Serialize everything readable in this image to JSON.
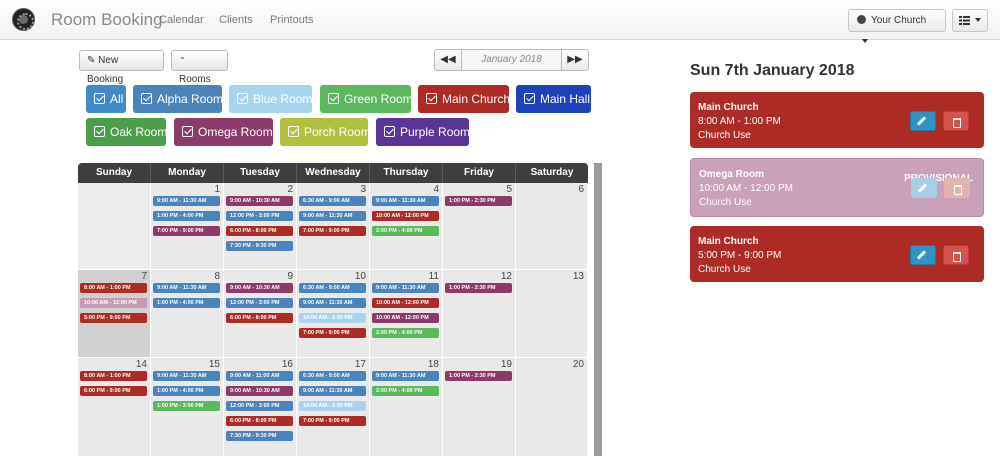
{
  "navbar": {
    "brand": "Room Booking",
    "links": [
      "Calendar",
      "Clients",
      "Printouts"
    ],
    "church_selector": "Your Church"
  },
  "toolbar": {
    "new_booking": "New Booking",
    "rooms": "Rooms",
    "month_label": "January 2018"
  },
  "rooms": [
    {
      "label": "All",
      "color": "#428bca"
    },
    {
      "label": "Alpha Room",
      "color": "#4a84bb"
    },
    {
      "label": "Blue Room",
      "color": "#a9d4ee"
    },
    {
      "label": "Green Room",
      "color": "#5cb85c"
    },
    {
      "label": "Main Church",
      "color": "#ac2b24"
    },
    {
      "label": "Main Hall",
      "color": "#1c44b8"
    },
    {
      "label": "Oak Room",
      "color": "#4b9f4b"
    },
    {
      "label": "Omega Room",
      "color": "#8b3a6a"
    },
    {
      "label": "Porch Room",
      "color": "#b3bf3e"
    },
    {
      "label": "Purple Room",
      "color": "#5b3596"
    }
  ],
  "calendar": {
    "weekdays": [
      "Sunday",
      "Monday",
      "Tuesday",
      "Wednesday",
      "Thursday",
      "Friday",
      "Saturday"
    ],
    "weeks": [
      {
        "days": [
          {
            "num": "",
            "events": []
          },
          {
            "num": "1",
            "events": [
              [
                "9:00 AM - 11:30 AM",
                "#4a84bb"
              ],
              [
                "1:00 PM - 4:00 PM",
                "#4a84bb"
              ],
              [
                "7:00 PM - 9:00 PM",
                "#8b3a6a"
              ]
            ]
          },
          {
            "num": "2",
            "events": [
              [
                "9:00 AM - 10:30 AM",
                "#8b3a6a"
              ],
              [
                "12:00 PM - 3:00 PM",
                "#4a84bb"
              ],
              [
                "6:00 PM - 8:00 PM",
                "#ac2b24"
              ],
              [
                "7:30 PM - 9:30 PM",
                "#4a84bb"
              ]
            ]
          },
          {
            "num": "3",
            "events": [
              [
                "6:30 AM - 9:00 AM",
                "#4a84bb"
              ],
              [
                "9:00 AM - 11:30 AM",
                "#4a84bb"
              ],
              [
                "7:00 PM - 9:00 PM",
                "#ac2b24"
              ]
            ]
          },
          {
            "num": "4",
            "events": [
              [
                "9:00 AM - 11:30 AM",
                "#4a84bb"
              ],
              [
                "10:00 AM - 12:00 PM",
                "#ac2b24"
              ],
              [
                "2:00 PM - 4:00 PM",
                "#5cb85c"
              ]
            ]
          },
          {
            "num": "5",
            "events": [
              [
                "1:00 PM - 2:30 PM",
                "#8b3a6a"
              ]
            ]
          },
          {
            "num": "6",
            "events": []
          }
        ]
      },
      {
        "days": [
          {
            "num": "7",
            "events": [
              [
                "8:00 AM - 1:00 PM",
                "#ac2b24"
              ],
              [
                "10:00 AM - 12:00 PM",
                "#c49bb3"
              ],
              [
                "5:00 PM - 9:00 PM",
                "#ac2b24"
              ]
            ]
          },
          {
            "num": "8",
            "events": [
              [
                "9:00 AM - 11:30 AM",
                "#4a84bb"
              ],
              [
                "1:00 PM - 4:00 PM",
                "#4a84bb"
              ]
            ]
          },
          {
            "num": "9",
            "events": [
              [
                "9:00 AM - 10:30 AM",
                "#8b3a6a"
              ],
              [
                "12:00 PM - 3:00 PM",
                "#4a84bb"
              ],
              [
                "6:00 PM - 8:00 PM",
                "#ac2b24"
              ]
            ]
          },
          {
            "num": "10",
            "events": [
              [
                "6:30 AM - 9:00 AM",
                "#4a84bb"
              ],
              [
                "9:00 AM - 11:30 AM",
                "#4a84bb"
              ],
              [
                "10:00 AM - 1:00 PM",
                "#a9d4ee"
              ],
              [
                "7:00 PM - 9:00 PM",
                "#ac2b24"
              ]
            ]
          },
          {
            "num": "11",
            "events": [
              [
                "9:00 AM - 11:30 AM",
                "#4a84bb"
              ],
              [
                "10:00 AM - 12:00 PM",
                "#ac2b24"
              ],
              [
                "10:00 AM - 12:00 PM",
                "#8b3a6a"
              ],
              [
                "2:00 PM - 4:00 PM",
                "#5cb85c"
              ]
            ]
          },
          {
            "num": "12",
            "events": [
              [
                "1:00 PM - 2:30 PM",
                "#8b3a6a"
              ]
            ]
          },
          {
            "num": "13",
            "events": []
          }
        ]
      },
      {
        "days": [
          {
            "num": "14",
            "events": [
              [
                "8:00 AM - 1:00 PM",
                "#ac2b24"
              ],
              [
                "6:00 PM - 9:00 PM",
                "#ac2b24"
              ]
            ]
          },
          {
            "num": "15",
            "events": [
              [
                "9:00 AM - 11:30 AM",
                "#4a84bb"
              ],
              [
                "1:00 PM - 4:00 PM",
                "#4a84bb"
              ],
              [
                "1:00 PM - 3:00 PM",
                "#5cb85c"
              ]
            ]
          },
          {
            "num": "16",
            "events": [
              [
                "9:00 AM - 11:00 AM",
                "#4a84bb"
              ],
              [
                "9:00 AM - 10:30 AM",
                "#8b3a6a"
              ],
              [
                "12:00 PM - 3:00 PM",
                "#4a84bb"
              ],
              [
                "6:00 PM - 8:00 PM",
                "#ac2b24"
              ],
              [
                "7:30 PM - 9:30 PM",
                "#4a84bb"
              ]
            ]
          },
          {
            "num": "17",
            "events": [
              [
                "6:30 AM - 9:00 AM",
                "#4a84bb"
              ],
              [
                "9:00 AM - 11:30 AM",
                "#4a84bb"
              ],
              [
                "10:00 AM - 1:00 PM",
                "#a9d4ee"
              ],
              [
                "7:00 PM - 9:00 PM",
                "#ac2b24"
              ]
            ]
          },
          {
            "num": "18",
            "events": [
              [
                "9:00 AM - 11:30 AM",
                "#4a84bb"
              ],
              [
                "2:00 PM - 4:00 PM",
                "#5cb85c"
              ]
            ]
          },
          {
            "num": "19",
            "events": [
              [
                "1:00 PM - 2:30 PM",
                "#8b3a6a"
              ]
            ]
          },
          {
            "num": "20",
            "events": []
          }
        ]
      }
    ]
  },
  "day_panel": {
    "title": "Sun 7th January 2018",
    "bookings": [
      {
        "room": "Main Church",
        "time": "8:00 AM - 1:00 PM",
        "use": "Church Use",
        "status": "",
        "color": "#ac2b24"
      },
      {
        "room": "Omega Room",
        "time": "10:00 AM - 12:00 PM",
        "use": "Church Use",
        "status": "PROVISIONAL",
        "color": "#c9a1b9"
      },
      {
        "room": "Main Church",
        "time": "5:00 PM - 9:00 PM",
        "use": "Church Use",
        "status": "",
        "color": "#ac2b24"
      }
    ]
  }
}
